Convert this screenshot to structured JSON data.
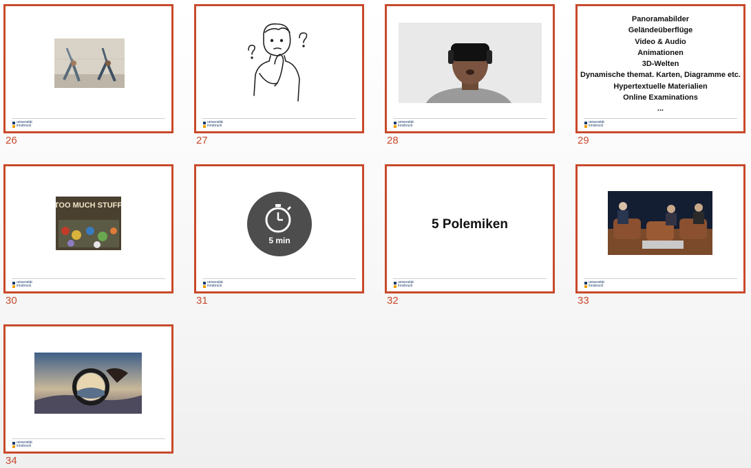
{
  "slides": [
    {
      "number": "26"
    },
    {
      "number": "27"
    },
    {
      "number": "28"
    },
    {
      "number": "29",
      "lines": [
        "Panoramabilder",
        "Geländeüberflüge",
        "Video & Audio",
        "Animationen",
        "3D-Welten",
        "Dynamische themat. Karten, Diagramme etc.",
        "Hypertextuelle Materialien",
        "Online Examinations",
        "..."
      ]
    },
    {
      "number": "30",
      "image_text": "TOO MUCH STUFF"
    },
    {
      "number": "31",
      "timer_label": "5 min"
    },
    {
      "number": "32",
      "title": "5 Polemiken"
    },
    {
      "number": "33"
    },
    {
      "number": "34"
    }
  ],
  "footer": {
    "logo_top": "universität",
    "logo_bottom": "innsbruck"
  },
  "colors": {
    "accent": "#c8492a",
    "logo_blue": "#1b3a6b",
    "logo_orange": "#f0a000"
  }
}
